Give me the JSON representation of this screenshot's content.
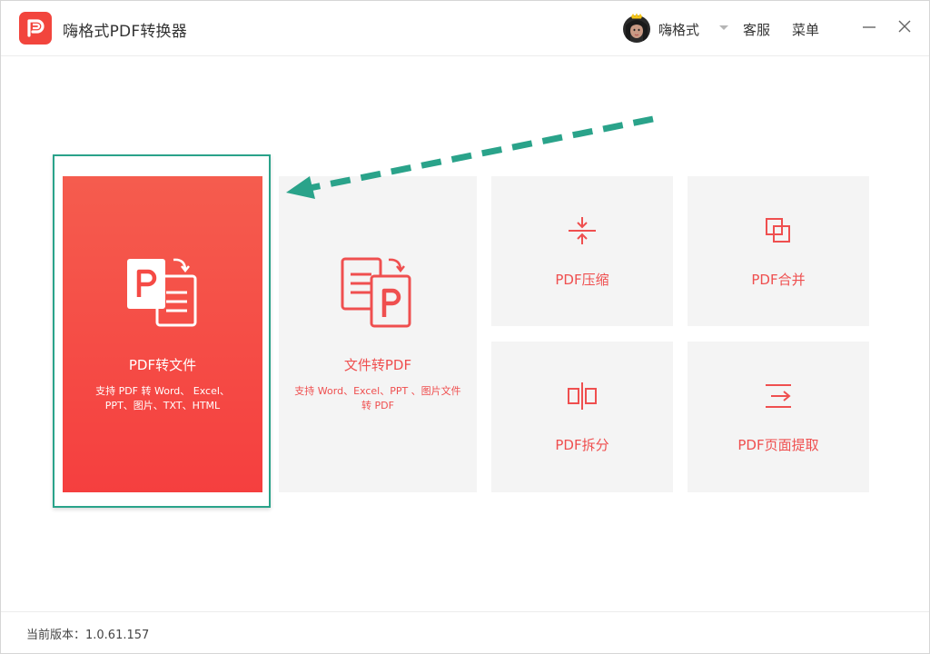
{
  "app": {
    "title": "嗨格式PDF转换器"
  },
  "header": {
    "username": "嗨格式",
    "support_label": "客服",
    "menu_label": "菜单"
  },
  "tiles": {
    "pdf_to_file": {
      "title": "PDF转文件",
      "desc": "支持 PDF 转 Word、 Excel、PPT、图片、TXT、HTML"
    },
    "file_to_pdf": {
      "title": "文件转PDF",
      "desc": "支持 Word、Excel、PPT 、图片文件转 PDF"
    },
    "compress": {
      "label": "PDF压缩"
    },
    "merge": {
      "label": "PDF合并"
    },
    "split": {
      "label": "PDF拆分"
    },
    "extract": {
      "label": "PDF页面提取"
    }
  },
  "footer": {
    "version_text": "当前版本：1.0.61.157"
  },
  "colors": {
    "accent": "#ef4f4f",
    "highlight": "#2aa38a",
    "tile_bg": "#f4f4f4"
  }
}
